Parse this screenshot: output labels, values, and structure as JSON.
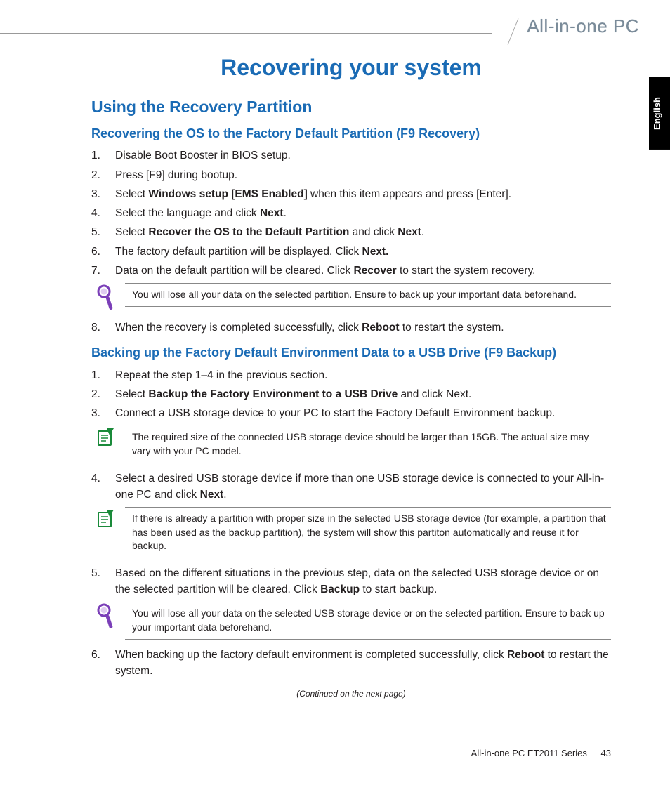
{
  "brand": "All-in-one PC",
  "lang_tab": "English",
  "chapter_title": "Recovering your system",
  "section_title": "Using the Recovery Partition",
  "sub1": {
    "title": "Recovering the OS to the Factory Default Partition (F9 Recovery)",
    "steps": {
      "s1": "Disable Boot Booster in BIOS setup.",
      "s2": "Press [F9] during bootup.",
      "s3a": "Select ",
      "s3b": "Windows setup [EMS Enabled]",
      "s3c": " when this item appears and press [Enter].",
      "s4a": "Select the language and click ",
      "s4b": "Next",
      "s4c": ".",
      "s5a": "Select ",
      "s5b": "Recover the OS to the Default Partition",
      "s5c": " and click ",
      "s5d": "Next",
      "s5e": ".",
      "s6a": "The factory default partition will be displayed. Click ",
      "s6b": "Next.",
      "s7a": "Data on the default partition will be cleared. Click ",
      "s7b": "Recover",
      "s7c": " to start the system recovery.",
      "s8a": "When the recovery is completed successfully, click ",
      "s8b": "Reboot",
      "s8c": " to restart the system."
    },
    "warn": "You will lose all your data on the selected partition. Ensure to back up your important data beforehand."
  },
  "sub2": {
    "title": "Backing up the Factory Default Environment Data to a USB Drive (F9 Backup)",
    "steps": {
      "s1": "Repeat the step 1–4 in the previous section.",
      "s2a": "Select ",
      "s2b": "Backup the Factory Environment to a USB Drive",
      "s2c": " and click Next.",
      "s3": "Connect a USB storage device to your PC to start the Factory Default Environment backup.",
      "s4a": "Select a desired USB storage device if more than one USB storage device is connected to your All-in-one PC and click ",
      "s4b": "Next",
      "s4c": ".",
      "s5a": "Based on the different situations in the previous step, data on the selected USB storage device or on the selected partition will be cleared. Click ",
      "s5b": "Backup",
      "s5c": " to start backup.",
      "s6a": "When backing up the factory default environment is completed successfully, click ",
      "s6b": "Reboot",
      "s6c": " to restart the system."
    },
    "note1": "The required size of the connected USB storage device should be larger than 15GB. The actual size may vary with your PC model.",
    "note2": "If there is already a partition with proper size in the selected USB storage device (for example, a partition that has been used as the backup partition), the system will show this partiton automatically and reuse it for backup.",
    "warn": "You will lose all your data on the selected USB storage device or on the selected partition. Ensure to back up your important data beforehand."
  },
  "continued": "(Continued on the next page)",
  "footer_model": "All-in-one PC ET2011 Series",
  "page_number": "43"
}
